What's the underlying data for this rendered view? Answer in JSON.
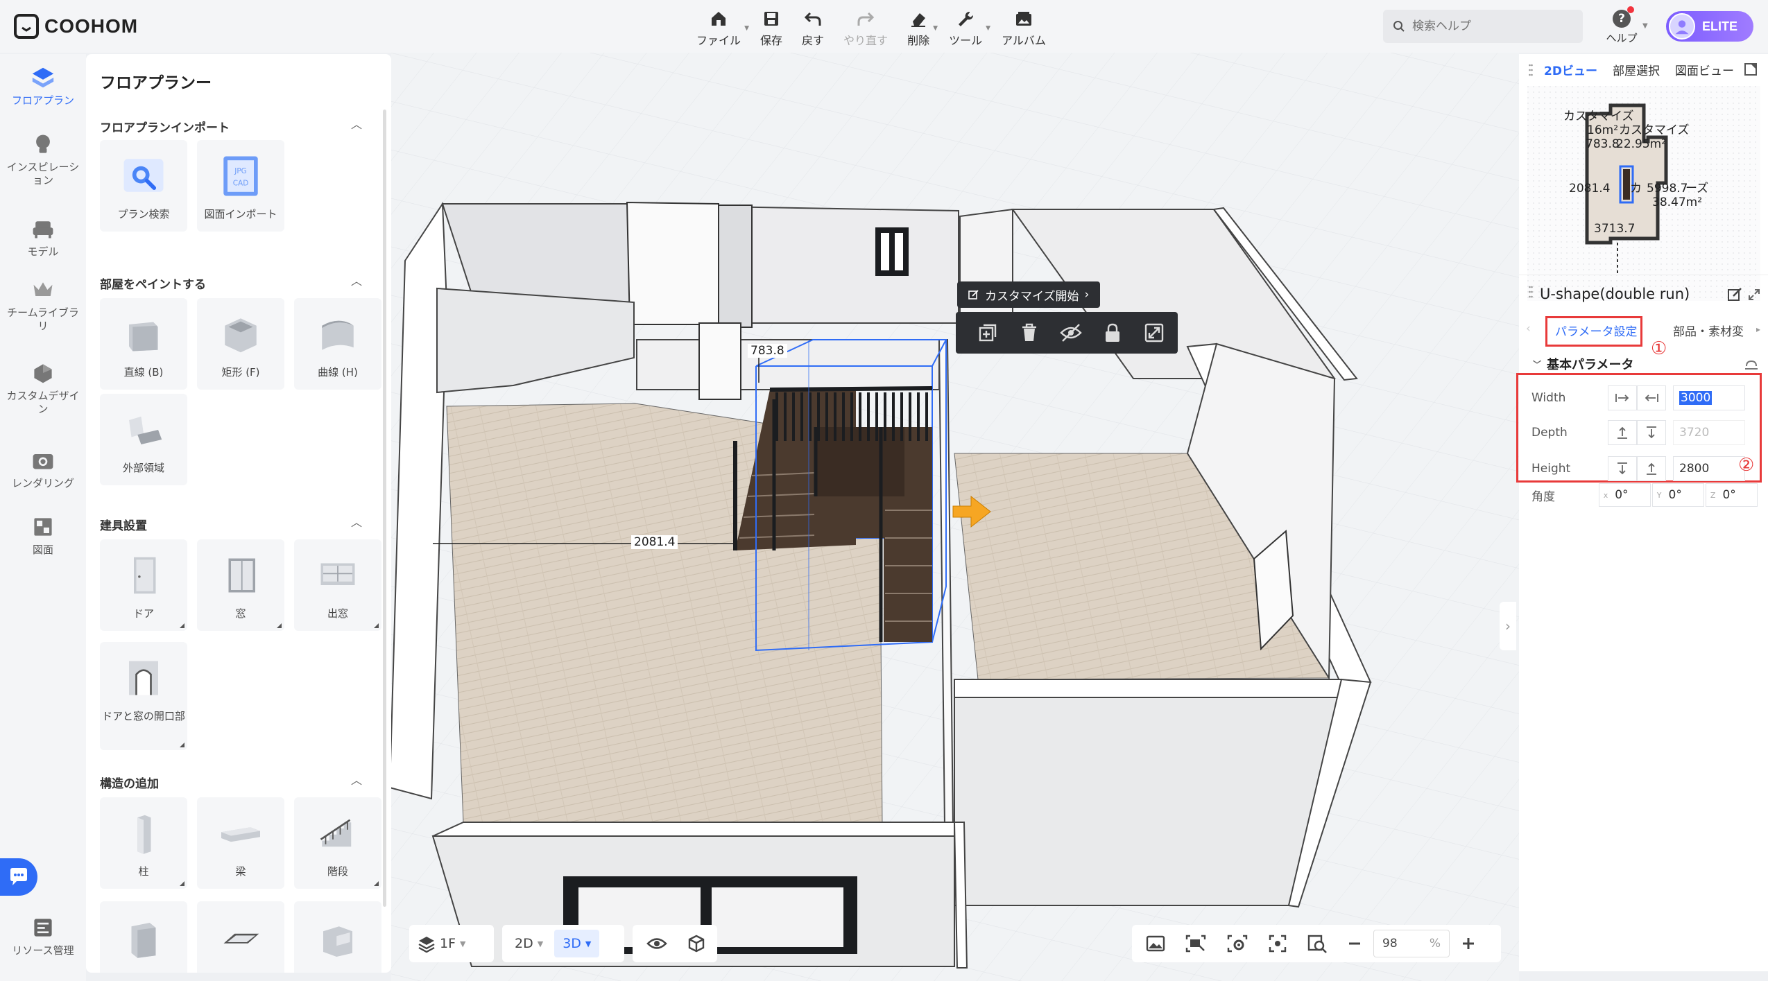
{
  "app": {
    "logo_text": "COOHOM"
  },
  "toolbar": {
    "file": "ファイル",
    "save": "保存",
    "undo": "戻す",
    "redo": "やり直す",
    "delete": "削除",
    "tools": "ツール",
    "album": "アルバム"
  },
  "search": {
    "placeholder": "検索ヘルプ"
  },
  "help": {
    "label": "ヘルプ"
  },
  "user": {
    "badge": "ELITE"
  },
  "rail": [
    {
      "label": "フロアプラン",
      "icon": "floorplan-icon"
    },
    {
      "label": "インスピレーション",
      "icon": "lightbulb-icon"
    },
    {
      "label": "モデル",
      "icon": "sofa-icon"
    },
    {
      "label": "チームライブラリ",
      "icon": "crown-icon"
    },
    {
      "label": "カスタムデザイン",
      "icon": "custom-design-icon"
    },
    {
      "label": "レンダリング",
      "icon": "camera-icon"
    },
    {
      "label": "図面",
      "icon": "drawing-icon"
    },
    {
      "label": "リソース管理",
      "icon": "resource-icon"
    }
  ],
  "library": {
    "title": "フロアプランー",
    "sections": {
      "import": {
        "title": "フロアプランインポート",
        "items": [
          "プラン検索",
          "図面インポート"
        ]
      },
      "paint": {
        "title": "部屋をペイントする",
        "items": [
          "直線 (B)",
          "矩形 (F)",
          "曲線 (H)",
          "外部領域"
        ]
      },
      "openings": {
        "title": "建具設置",
        "items": [
          "ドア",
          "窓",
          "出窓",
          "ドアと窓の開口部"
        ]
      },
      "structure": {
        "title": "構造の追加",
        "items": [
          "柱",
          "梁",
          "階段"
        ]
      }
    },
    "import_badges": [
      "JPG",
      "CAD"
    ]
  },
  "canvas": {
    "context_pill": "カスタマイズ開始",
    "dimensions": [
      "783.8",
      "2081.4"
    ],
    "floor": "1F",
    "view_2d": "2D",
    "view_3d": "3D",
    "zoom_value": "98",
    "zoom_unit": "%"
  },
  "right": {
    "tabs": [
      "2Dビュー",
      "部屋選択",
      "図面ビュー"
    ],
    "minimap": {
      "labels": [
        "カスタマイズ",
        "16m²",
        "カスタマイズ",
        "783.8",
        "22.95m²",
        "2081.4",
        "カ",
        "5998.7",
        "ーズ",
        "38.47m²",
        "3713.7"
      ]
    },
    "object_title": "U-shape(double run)",
    "subtabs": [
      "パラメータ設定",
      "部品・素材変"
    ],
    "group_title": "基本パラメータ",
    "params": [
      {
        "label": "Width",
        "value": "3000"
      },
      {
        "label": "Depth",
        "value": "3720"
      },
      {
        "label": "Height",
        "value": "2800"
      }
    ],
    "angle": {
      "label": "角度",
      "x_axis": "x",
      "y_axis": "Y",
      "z_axis": "Z",
      "x": "0°",
      "y": "0°",
      "z": "0°"
    },
    "markers": [
      "①",
      "②"
    ]
  },
  "colors": {
    "accent": "#2f6cf6",
    "highlight_red": "#e83a3a",
    "elite_purple": "#7b5cff"
  }
}
